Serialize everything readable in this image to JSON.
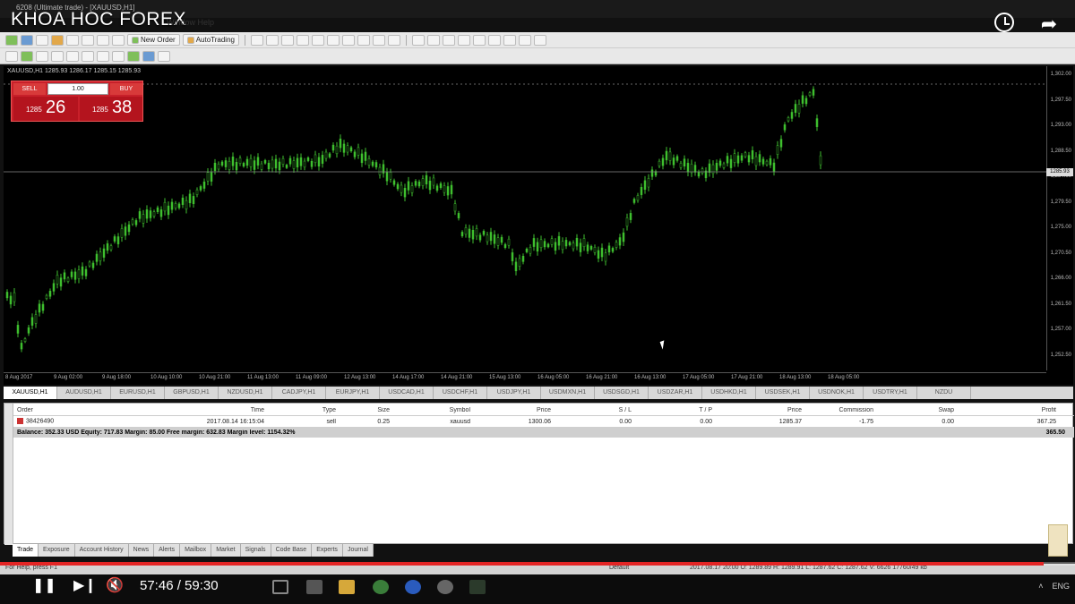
{
  "window": {
    "caption": "6208 (Ultimate trade) - [XAUUSD,H1]",
    "channel_overlay": "KHOA HOC FOREX",
    "menu_extra": "Window   Help"
  },
  "toolbar": {
    "new_order_label": "New Order",
    "autotrading_label": "AutoTrading"
  },
  "chart": {
    "header": "XAUUSD,H1  1285.93 1286.17 1285.15 1285.93",
    "price_levels": [
      "1,302.00",
      "1,297.50",
      "1,293.00",
      "1,288.50",
      "1,284.00",
      "1,279.50",
      "1,275.00",
      "1,270.50",
      "1,266.00",
      "1,261.50",
      "1,257.00",
      "1,252.50"
    ],
    "current_price": "1285.93",
    "time_labels": [
      "8 Aug 2017",
      "9 Aug 02:00",
      "9 Aug 18:00",
      "10 Aug 10:00",
      "10 Aug 21:00",
      "11 Aug 13:00",
      "11 Aug 09:00",
      "12 Aug 13:00",
      "14 Aug 17:00",
      "14 Aug 21:00",
      "15 Aug 13:00",
      "16 Aug 05:00",
      "16 Aug 21:00",
      "16 Aug 13:00",
      "17 Aug 05:00",
      "17 Aug 21:00",
      "18 Aug 13:00",
      "18 Aug 05:00"
    ],
    "candle_color": "#3fbf2f"
  },
  "one_click": {
    "sell_label": "SELL",
    "buy_label": "BUY",
    "lot_value": "1.00",
    "sell_small": "1285",
    "sell_big": "26",
    "buy_small": "1285",
    "buy_big": "38"
  },
  "symbol_tabs": [
    "XAUUSD,H1",
    "AUDUSD,H1",
    "EURUSD,H1",
    "GBPUSD,H1",
    "NZDUSD,H1",
    "CADJPY,H1",
    "EURJPY,H1",
    "USDCAD,H1",
    "USDCHF,H1",
    "USDJPY,H1",
    "USDMXN,H1",
    "USDSGD,H1",
    "USDZAR,H1",
    "USDHKD,H1",
    "USDSEK,H1",
    "USDNOK,H1",
    "USDTRY,H1",
    "NZDU"
  ],
  "terminal": {
    "columns": {
      "order": "Order",
      "time": "Time",
      "type": "Type",
      "size": "Size",
      "symbol": "Symbol",
      "price": "Price",
      "sl": "S / L",
      "tp": "T / P",
      "price2": "Price",
      "commission": "Commission",
      "swap": "Swap",
      "profit": "Profit"
    },
    "order_row": {
      "order": "38426490",
      "time": "2017.08.14 16:15:04",
      "type": "sell",
      "size": "0.25",
      "symbol": "xauusd",
      "price": "1300.06",
      "sl": "0.00",
      "tp": "0.00",
      "price2": "1285.37",
      "commission": "-1.75",
      "swap": "0.00",
      "profit": "367.25"
    },
    "balance_text": "Balance: 352.33 USD  Equity: 717.83  Margin: 85.00  Free margin: 632.83  Margin level: 1154.32%",
    "balance_profit": "365.50"
  },
  "bottom_tabs": [
    "Trade",
    "Exposure",
    "Account History",
    "News",
    "Alerts",
    "Mailbox",
    "Market",
    "Signals",
    "Code Base",
    "Experts",
    "Journal"
  ],
  "statusbar": {
    "help": "For Help, press F1",
    "profile": "Default",
    "info": "2017.08.17 20:00   O: 1289.89   H: 1289.91   L: 1287.62   C: 1287.62   V: 6626      17760/49 kb"
  },
  "video": {
    "time": "57:46 / 59:30",
    "progress": 0.971
  },
  "tray": {
    "lang": "ENG"
  }
}
